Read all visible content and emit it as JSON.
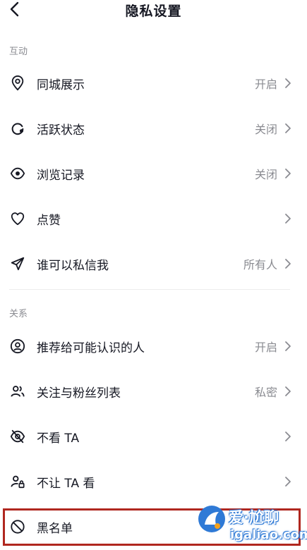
{
  "header": {
    "title": "隐私设置",
    "back_icon": "chevron-left-icon"
  },
  "sections": {
    "interaction": "互动",
    "relations": "关系"
  },
  "items": {
    "local_display": {
      "label": "同城展示",
      "value": "开启",
      "icon": "location-pin-icon"
    },
    "active_status": {
      "label": "活跃状态",
      "value": "关闭",
      "icon": "activity-status-icon"
    },
    "browse_history": {
      "label": "浏览记录",
      "value": "关闭",
      "icon": "eye-icon"
    },
    "likes": {
      "label": "点赞",
      "value": "",
      "icon": "heart-icon"
    },
    "direct_message": {
      "label": "谁可以私信我",
      "value": "所有人",
      "icon": "send-icon"
    },
    "recommend": {
      "label": "推荐给可能认识的人",
      "value": "开启",
      "icon": "user-circle-icon"
    },
    "follow_list": {
      "label": "关注与粉丝列表",
      "value": "私密",
      "icon": "users-icon"
    },
    "dont_see": {
      "label": "不看 TA",
      "value": "",
      "icon": "eye-off-icon"
    },
    "dont_let_see": {
      "label": "不让 TA 看",
      "value": "",
      "icon": "user-lock-icon"
    },
    "blacklist": {
      "label": "黑名单",
      "value": "",
      "icon": "block-icon"
    }
  },
  "watermark": {
    "brand": "爱·尬聊",
    "url": "igaliao.com"
  },
  "colors": {
    "text": "#161823",
    "secondary": "#8a8b91",
    "highlight_border": "#b0271f",
    "watermark_blue": "#2f7ad6"
  }
}
